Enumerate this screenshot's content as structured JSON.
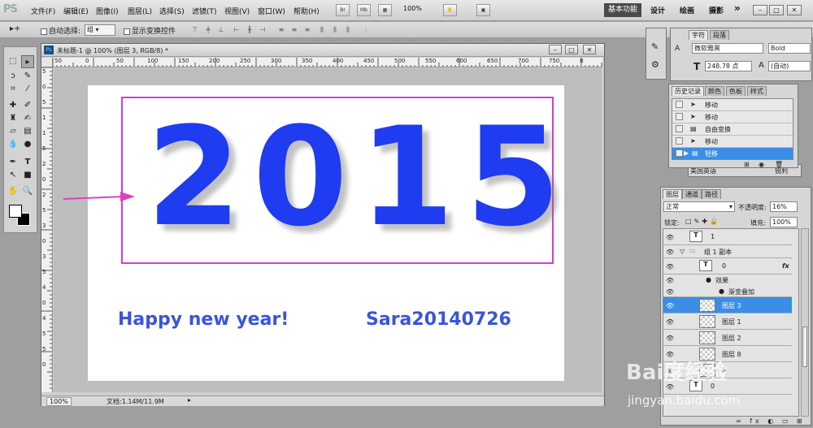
{
  "app": {
    "logo": "PS"
  },
  "menus": [
    "文件(F)",
    "编辑(E)",
    "图像(I)",
    "图层(L)",
    "选择(S)",
    "滤镜(T)",
    "视图(V)",
    "窗口(W)",
    "帮助(H)"
  ],
  "menubar": {
    "br": "Br",
    "mb": "Mb",
    "zoom": "100%",
    "workspaces": [
      "基本功能",
      "设计",
      "绘画",
      "摄影"
    ],
    "more": "»"
  },
  "options": {
    "auto_select_label": "自动选择:",
    "auto_select_value": "组",
    "show_transform_label": "显示变换控件"
  },
  "document": {
    "tab_title": "未标题-1 @ 100% (图层 3, RGB/8) *",
    "ruler_h": [
      "50",
      "0",
      "50",
      "100",
      "150",
      "200",
      "250",
      "300",
      "350",
      "400",
      "450",
      "500",
      "550",
      "600",
      "650",
      "700",
      "750",
      "8"
    ],
    "ruler_v": [
      "5",
      "0",
      "5",
      "1",
      "1",
      "5",
      "2",
      "0",
      "2",
      "5",
      "3",
      "0",
      "3",
      "5",
      "4",
      "0",
      "4",
      "5",
      "5",
      "0"
    ],
    "zoom": "100%",
    "doc_size": "文档:1.14M/11.9M"
  },
  "canvas": {
    "year": "2015",
    "greeting": "Happy new year!",
    "author": "Sara20140726",
    "colors": {
      "year": "#1f3cf0",
      "text": "#3a55d6",
      "frame": "#d63bd0",
      "arrow": "#e040c0"
    }
  },
  "char_panel": {
    "tabs": [
      "字符",
      "段落"
    ],
    "font_family": "微软雅黑",
    "font_style": "Bold",
    "size": "248.78 点",
    "leading": "(自动)",
    "lang": "美国英语",
    "aa": "锐利"
  },
  "history_panel": {
    "tabs": [
      "历史记录",
      "颜色",
      "色板",
      "样式"
    ],
    "items": [
      "移动",
      "移动",
      "自由变换",
      "移动",
      "轻移"
    ]
  },
  "layers_panel": {
    "tabs": [
      "图层",
      "通道",
      "路径"
    ],
    "blend": "正常",
    "opacity_label": "不透明度:",
    "opacity": "16%",
    "lock_label": "锁定:",
    "fill_label": "填充:",
    "fill": "100%",
    "layers": [
      {
        "name": "1",
        "type": "text"
      },
      {
        "name": "组 1 副本",
        "type": "group"
      },
      {
        "name": "0",
        "type": "text",
        "fx": "fx"
      },
      {
        "name": "效果",
        "type": "effect"
      },
      {
        "name": "渐变叠加",
        "type": "effect"
      },
      {
        "name": "图层 3",
        "type": "layer",
        "selected": true
      },
      {
        "name": "图层 1",
        "type": "layer"
      },
      {
        "name": "图层 2",
        "type": "layer"
      },
      {
        "name": "图层 8",
        "type": "layer"
      },
      {
        "name": "5",
        "type": "layer"
      },
      {
        "name": "0",
        "type": "text"
      }
    ]
  },
  "watermark": {
    "brand": "Bai度经验",
    "url": "jingyan.baidu.com"
  }
}
